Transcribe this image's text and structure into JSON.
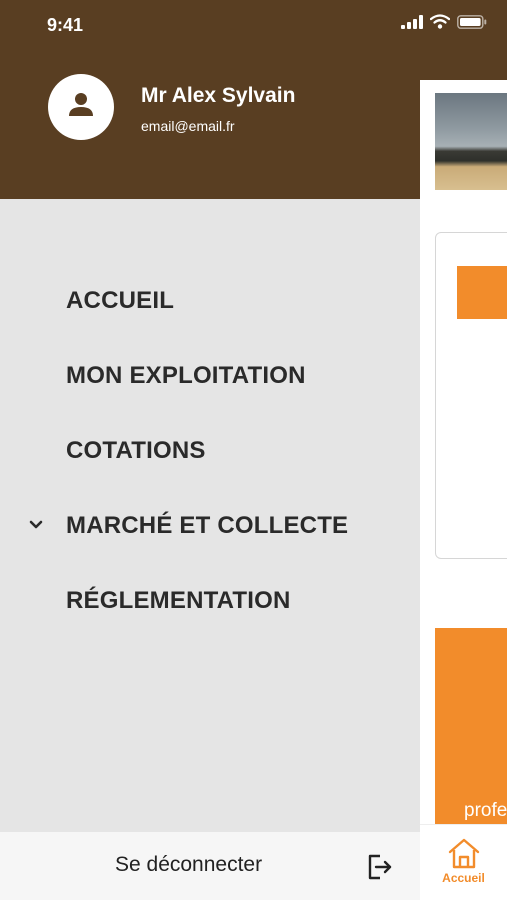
{
  "status_bar": {
    "time": "9:41",
    "icons": [
      "signal-icon",
      "wifi-icon",
      "battery-icon"
    ]
  },
  "drawer": {
    "user": {
      "name": "Mr Alex Sylvain",
      "email": "email@email.fr",
      "avatar_icon": "person-icon"
    },
    "menu": [
      {
        "label": "ACCUEIL"
      },
      {
        "label": "MON EXPLOITATION"
      },
      {
        "label": "COTATIONS"
      },
      {
        "label": "MARCHÉ ET COLLECTE",
        "icon": "chevron-down-icon"
      },
      {
        "label": "RÉGLEMENTATION"
      }
    ],
    "logout": {
      "label": "Se déconnecter",
      "icon": "logout-icon"
    }
  },
  "background": {
    "promo_text_partial": "profe",
    "tab_bar": {
      "active_tab": {
        "label": "Accueil",
        "icon": "home-icon"
      }
    }
  },
  "colors": {
    "header_brown": "#593e22",
    "accent_orange": "#f28c2b",
    "drawer_bg": "#e5e5e5",
    "menu_text": "#2a2a2a"
  }
}
